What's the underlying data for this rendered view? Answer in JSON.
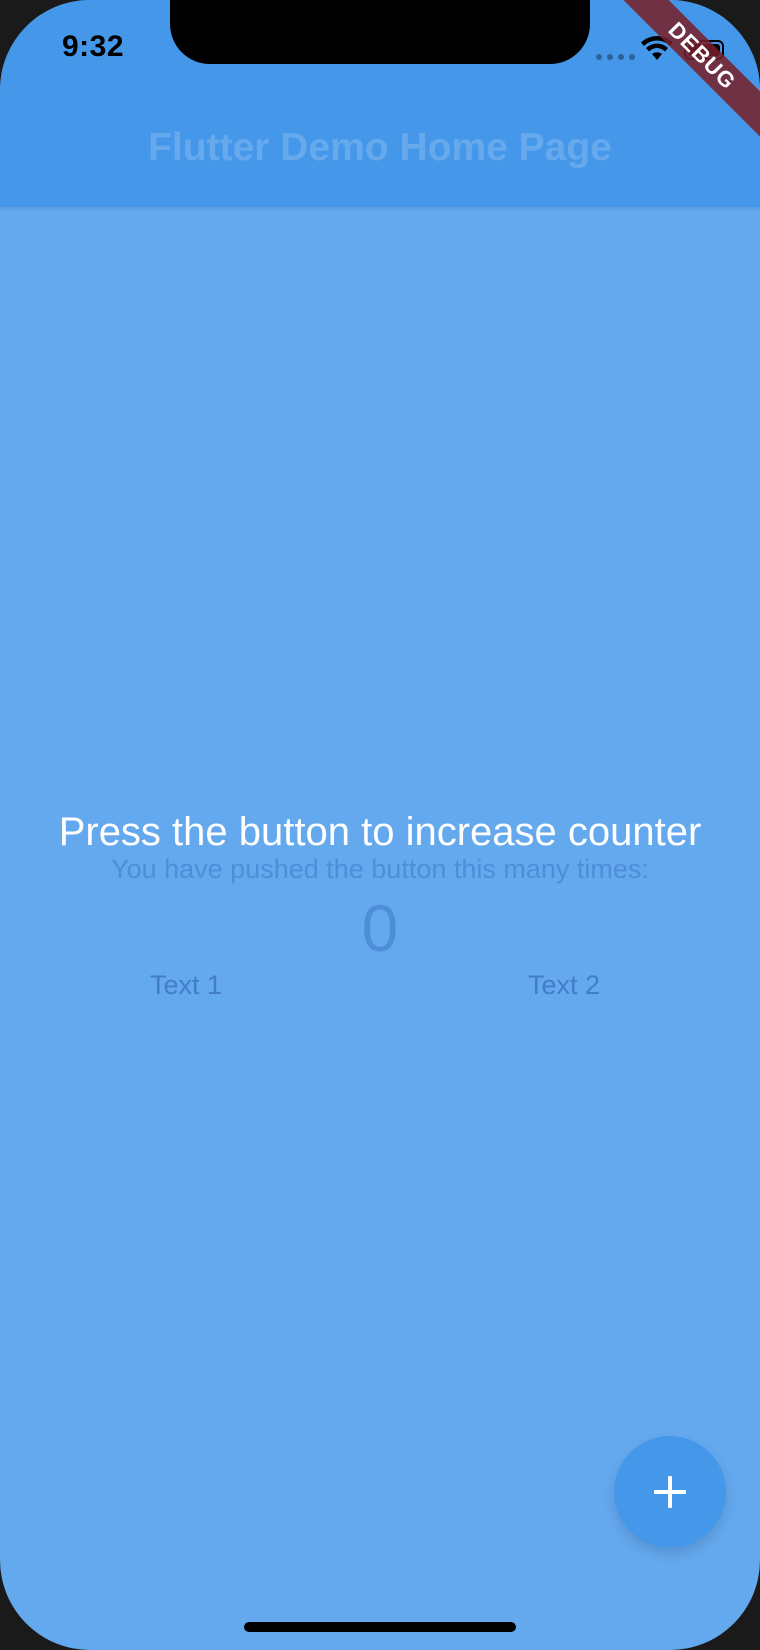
{
  "status_bar": {
    "time": "9:32"
  },
  "app_bar": {
    "title": "Flutter Demo Home Page"
  },
  "debug_banner": {
    "label": "DEBUG"
  },
  "body": {
    "overlay_message": "Press the button to increase counter",
    "counter_label": "You have pushed the button this many times:",
    "counter_value": "0",
    "text_left": "Text 1",
    "text_right": "Text 2"
  },
  "fab": {
    "icon": "add-icon"
  },
  "colors": {
    "app_bar": "#4597ea",
    "background": "#64a8ee",
    "fab": "#4597ea",
    "debug_banner": "#781e28"
  }
}
